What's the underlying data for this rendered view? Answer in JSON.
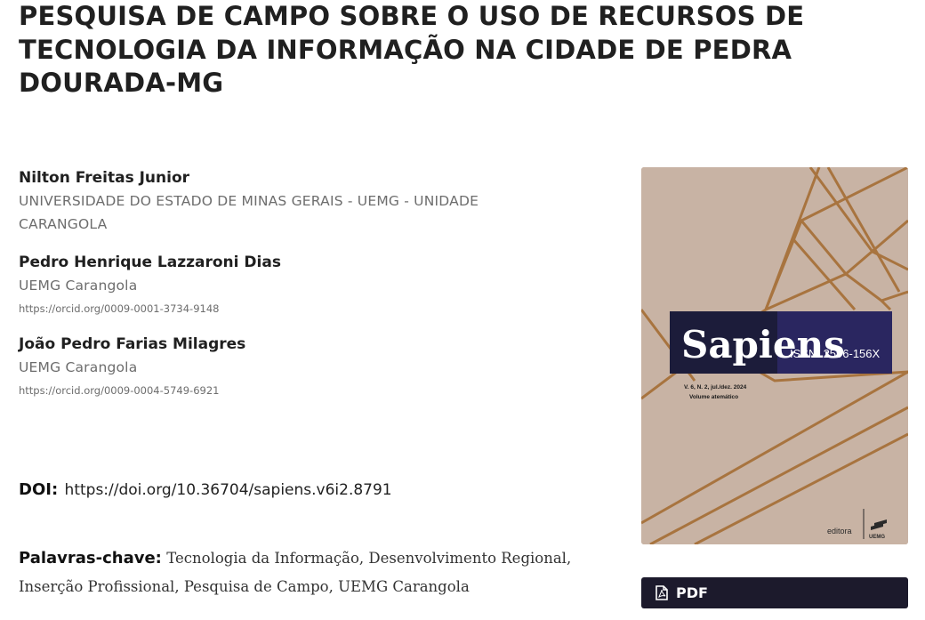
{
  "article": {
    "title": "PESQUISA DE CAMPO SOBRE O USO DE RECURSOS DE TECNOLOGIA DA INFORMAÇÃO NA CIDADE DE PEDRA DOURADA-MG"
  },
  "authors": [
    {
      "name": "Nilton Freitas Junior",
      "affiliation": "UNIVERSIDADE DO ESTADO DE MINAS GERAIS - UEMG - UNIDADE CARANGOLA"
    },
    {
      "name": "Pedro Henrique Lazzaroni Dias",
      "affiliation": "UEMG Carangola",
      "orcid": "https://orcid.org/0009-0001-3734-9148"
    },
    {
      "name": "João Pedro Farias Milagres",
      "affiliation": "UEMG Carangola",
      "orcid": "https://orcid.org/0009-0004-5749-6921"
    }
  ],
  "doi": {
    "label": "DOI:",
    "link": "https://doi.org/10.36704/sapiens.v6i2.8791"
  },
  "keywords": {
    "label": "Palavras-chave:",
    "text": "Tecnologia da Informação, Desenvolvimento Regional, Inserção Profissional, Pesquisa de Campo, UEMG Carangola"
  },
  "cover": {
    "journal_name": "Sapiens",
    "issn": "ISSN: 2596-156X",
    "issue": "V. 6, N. 2, jul./dez. 2024",
    "volume_note": "Volume atemático",
    "publisher": "editora",
    "publisher_logo_text": "UEMG",
    "background_color": "#c8b3a4",
    "line_color": "#a8743f",
    "banner_color": "#1c1c3a"
  },
  "pdf_button": {
    "label": "PDF",
    "icon": "pdf-file-icon",
    "color": "#1c1a2c"
  }
}
